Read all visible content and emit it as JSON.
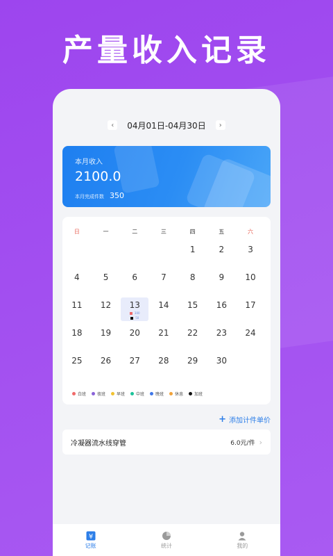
{
  "hero_title": "产量收入记录",
  "date_bar": {
    "range": "04月01日-04月30日",
    "prev": "‹",
    "next": "›"
  },
  "income_card": {
    "label": "本月收入",
    "value": "2100.0",
    "done_label": "本月完成件数",
    "done_value": "350"
  },
  "calendar": {
    "weekdays": [
      "日",
      "一",
      "二",
      "三",
      "四",
      "五",
      "六"
    ],
    "weeks": [
      [
        "",
        "",
        "",
        "",
        "1",
        "2",
        "3"
      ],
      [
        "4",
        "5",
        "6",
        "7",
        "8",
        "9",
        "10"
      ],
      [
        "11",
        "12",
        "13",
        "14",
        "15",
        "16",
        "17"
      ],
      [
        "18",
        "19",
        "20",
        "21",
        "22",
        "23",
        "24"
      ],
      [
        "25",
        "26",
        "27",
        "28",
        "29",
        "30",
        ""
      ]
    ],
    "selected_day": "13",
    "selected_marks": [
      {
        "color": "#f06a6a",
        "value": "300"
      },
      {
        "color": "#111111",
        "value": "50"
      }
    ]
  },
  "legend": [
    {
      "label": "白班",
      "color": "#f06a6a"
    },
    {
      "label": "夜班",
      "color": "#8a63d8"
    },
    {
      "label": "早班",
      "color": "#f2c230"
    },
    {
      "label": "中班",
      "color": "#1cc39a"
    },
    {
      "label": "晚班",
      "color": "#3f77e8"
    },
    {
      "label": "休息",
      "color": "#f0a23a"
    },
    {
      "label": "加班",
      "color": "#111111"
    }
  ],
  "add_piece": {
    "label": "添加计件单价",
    "icon": "plus-icon"
  },
  "items": [
    {
      "name": "冷凝器流水线穿管",
      "price": "6.0元/件"
    }
  ],
  "tabbar": {
    "tabs": [
      {
        "label": "记账",
        "icon": "yen-icon",
        "active": true
      },
      {
        "label": "统计",
        "icon": "pie-chart-icon",
        "active": false
      },
      {
        "label": "我的",
        "icon": "user-icon",
        "active": false
      }
    ]
  },
  "colors": {
    "accent": "#2c7ee8",
    "background": "#a24ff0",
    "card": "#1e7ff0"
  }
}
